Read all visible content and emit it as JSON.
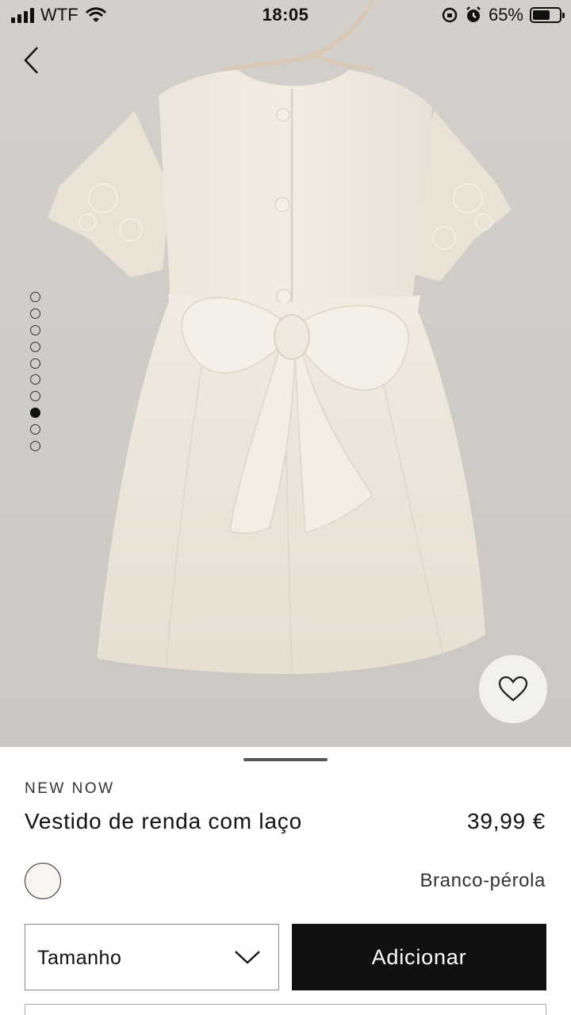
{
  "status_bar": {
    "carrier": "WTF",
    "time": "18:05",
    "battery_percent": "65%",
    "battery_level": 0.65,
    "icons": [
      "signal-icon",
      "wifi-icon",
      "rotation-lock-icon",
      "alarm-icon",
      "battery-icon"
    ]
  },
  "gallery": {
    "image_count": 10,
    "active_index": 7,
    "back_icon": "chevron-left-icon",
    "wishlist_icon": "heart-outline-icon"
  },
  "product": {
    "tag": "NEW NOW",
    "name": "Vestido de renda com laço",
    "price": "39,99 €",
    "color_name": "Branco-pérola",
    "color_hex": "#f8f5f0"
  },
  "actions": {
    "size_label": "Tamanho",
    "add_label": "Adicionar"
  },
  "theme": {
    "background": "#cfccc7",
    "dress": "#efe8dc",
    "button": "#111111"
  }
}
